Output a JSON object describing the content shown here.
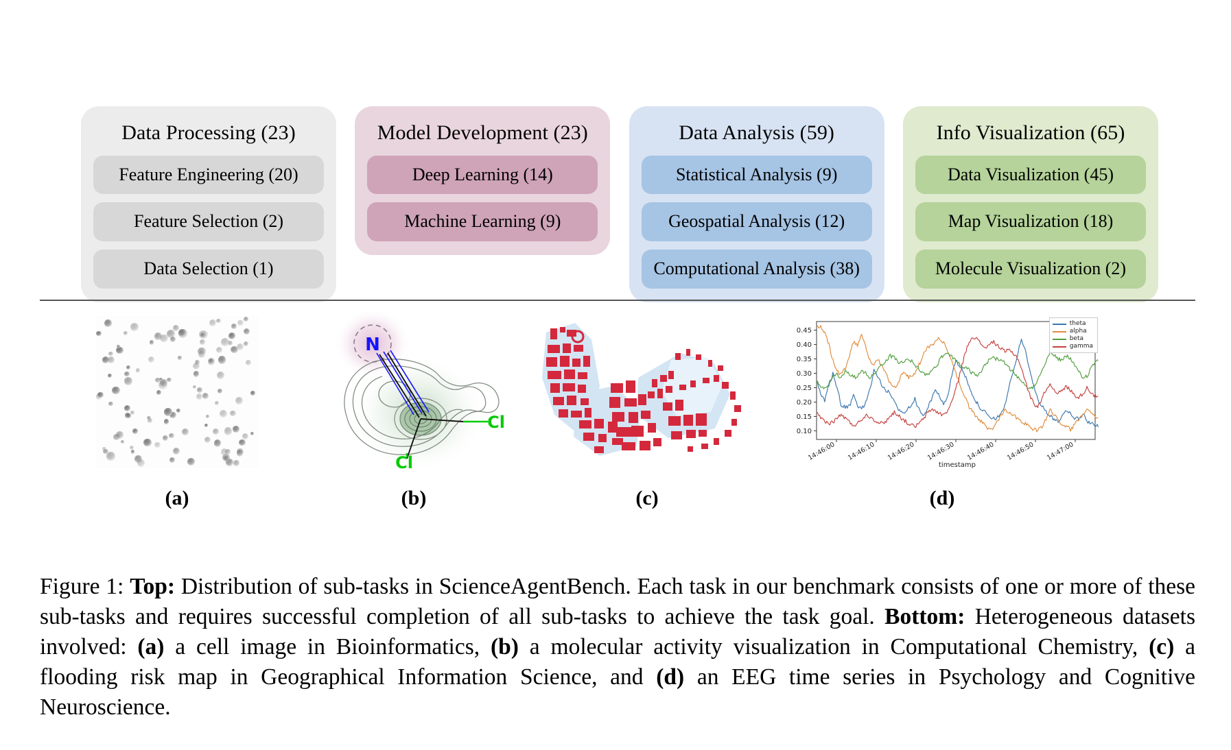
{
  "taxonomy": {
    "columns": [
      {
        "title": "Data Processing (23)",
        "panel_color": "#edecec",
        "chip_color": "#d7d7d7",
        "chips": [
          {
            "label": "Feature Engineering (20)"
          },
          {
            "label": "Feature Selection (2)"
          },
          {
            "label": "Data Selection (1)"
          }
        ]
      },
      {
        "title": "Model Development (23)",
        "panel_color": "#e9d5dd",
        "chip_color": "#cfa3b8",
        "chips": [
          {
            "label": "Deep Learning (14)"
          },
          {
            "label": "Machine Learning (9)"
          }
        ]
      },
      {
        "title": "Data Analysis (59)",
        "panel_color": "#d7e3f3",
        "chip_color": "#a6c4e4",
        "chips": [
          {
            "label": "Statistical Analysis (9)"
          },
          {
            "label": "Geospatial Analysis (12)"
          },
          {
            "label": "Computational Analysis (38)"
          }
        ]
      },
      {
        "title": "Info Visualization (65)",
        "panel_color": "#dfeacf",
        "chip_color": "#b5d39a",
        "chips": [
          {
            "label": "Data Visualization (45)"
          },
          {
            "label": "Map Visualization (18)"
          },
          {
            "label": "Molecule Visualization (2)"
          }
        ]
      }
    ]
  },
  "examples": [
    {
      "label": "(a)",
      "kind": "cell-image"
    },
    {
      "label": "(b)",
      "kind": "molecule-plot"
    },
    {
      "label": "(c)",
      "kind": "flood-risk-map"
    },
    {
      "label": "(d)",
      "kind": "eeg-time-series"
    }
  ],
  "molecule": {
    "atoms": [
      {
        "symbol": "N",
        "color": "#1414ff"
      },
      {
        "symbol": "Cl",
        "color": "#00cc00"
      }
    ]
  },
  "chart_data": {
    "type": "line",
    "title": "",
    "xlabel": "timestamp",
    "ylabel": "",
    "grid": false,
    "legend_position": "upper right",
    "ylim": [
      0.07,
      0.48
    ],
    "yticks": [
      "0.10",
      "0.15",
      "0.20",
      "0.25",
      "0.30",
      "0.35",
      "0.40",
      "0.45"
    ],
    "ytick_values": [
      0.1,
      0.15,
      0.2,
      0.25,
      0.3,
      0.35,
      0.4,
      0.45
    ],
    "xticks": [
      "14:46:00",
      "14:46:10",
      "14:46:20",
      "14:46:30",
      "14:46:40",
      "14:46:50",
      "14:47:00"
    ],
    "series": [
      {
        "name": "theta",
        "color": "#3a76af",
        "values": [
          0.27,
          0.23,
          0.2,
          0.26,
          0.3,
          0.25,
          0.19,
          0.18,
          0.185,
          0.22,
          0.19,
          0.175,
          0.2,
          0.24,
          0.31,
          0.29,
          0.255,
          0.24,
          0.23,
          0.2,
          0.175,
          0.16,
          0.175,
          0.19,
          0.21,
          0.175,
          0.155,
          0.17,
          0.21,
          0.24,
          0.22,
          0.195,
          0.22,
          0.29,
          0.35,
          0.32,
          0.3,
          0.265,
          0.23,
          0.2,
          0.18,
          0.165,
          0.15,
          0.14,
          0.145,
          0.16,
          0.19,
          0.25,
          0.31,
          0.36,
          0.42,
          0.38,
          0.31,
          0.255,
          0.21,
          0.19,
          0.165,
          0.15,
          0.14,
          0.135,
          0.15,
          0.175,
          0.16,
          0.145,
          0.14,
          0.16,
          0.135,
          0.125,
          0.12
        ]
      },
      {
        "name": "alpha",
        "color": "#e08b3c",
        "values": [
          0.465,
          0.46,
          0.44,
          0.4,
          0.345,
          0.305,
          0.295,
          0.32,
          0.36,
          0.41,
          0.4,
          0.435,
          0.39,
          0.345,
          0.33,
          0.345,
          0.33,
          0.3,
          0.265,
          0.25,
          0.27,
          0.3,
          0.29,
          0.285,
          0.3,
          0.33,
          0.36,
          0.39,
          0.395,
          0.41,
          0.425,
          0.405,
          0.38,
          0.345,
          0.3,
          0.26,
          0.225,
          0.19,
          0.165,
          0.15,
          0.135,
          0.12,
          0.105,
          0.11,
          0.13,
          0.155,
          0.175,
          0.165,
          0.155,
          0.145,
          0.135,
          0.125,
          0.115,
          0.105,
          0.1,
          0.115,
          0.14,
          0.175,
          0.155,
          0.135,
          0.125,
          0.115,
          0.105,
          0.12,
          0.14,
          0.16,
          0.18,
          0.165,
          0.15
        ]
      },
      {
        "name": "beta",
        "color": "#519e3e",
        "values": [
          0.275,
          0.255,
          0.245,
          0.26,
          0.285,
          0.295,
          0.285,
          0.31,
          0.3,
          0.285,
          0.29,
          0.305,
          0.3,
          0.285,
          0.3,
          0.315,
          0.33,
          0.345,
          0.36,
          0.355,
          0.34,
          0.335,
          0.35,
          0.345,
          0.33,
          0.315,
          0.3,
          0.295,
          0.305,
          0.32,
          0.345,
          0.365,
          0.37,
          0.36,
          0.345,
          0.33,
          0.32,
          0.315,
          0.3,
          0.29,
          0.3,
          0.325,
          0.345,
          0.355,
          0.35,
          0.345,
          0.335,
          0.32,
          0.3,
          0.285,
          0.27,
          0.255,
          0.245,
          0.255,
          0.28,
          0.31,
          0.345,
          0.37,
          0.365,
          0.35,
          0.345,
          0.36,
          0.35,
          0.33,
          0.305,
          0.285,
          0.29,
          0.315,
          0.34
        ]
      },
      {
        "name": "gamma",
        "color": "#c3423f",
        "values": [
          0.16,
          0.145,
          0.135,
          0.125,
          0.13,
          0.145,
          0.155,
          0.145,
          0.13,
          0.12,
          0.125,
          0.14,
          0.155,
          0.15,
          0.14,
          0.13,
          0.125,
          0.135,
          0.15,
          0.165,
          0.155,
          0.14,
          0.13,
          0.12,
          0.115,
          0.125,
          0.14,
          0.16,
          0.175,
          0.17,
          0.16,
          0.155,
          0.17,
          0.2,
          0.245,
          0.3,
          0.355,
          0.4,
          0.43,
          0.42,
          0.405,
          0.39,
          0.395,
          0.41,
          0.4,
          0.385,
          0.375,
          0.38,
          0.37,
          0.355,
          0.32,
          0.27,
          0.225,
          0.195,
          0.185,
          0.21,
          0.245,
          0.26,
          0.245,
          0.23,
          0.24,
          0.255,
          0.24,
          0.225,
          0.215,
          0.23,
          0.25,
          0.235,
          0.22
        ]
      }
    ]
  },
  "caption": {
    "prefix": "Figure 1:",
    "top_label": "Top:",
    "top_text": "Distribution of sub-tasks in ScienceAgentBench. Each task in our benchmark consists of one or more of these sub-tasks and requires successful completion of all sub-tasks to achieve the task goal.",
    "bottom_label": "Bottom:",
    "bottom_text_1": "Heterogeneous datasets involved:",
    "item_a_label": "(a)",
    "item_a_text": "a cell image in Bioinformatics,",
    "item_b_label": "(b)",
    "item_b_text": "a molecular activity visualization in Computational Chemistry,",
    "item_c_label": "(c)",
    "item_c_text": "a flooding risk map in Geographical Information Science, and",
    "item_d_label": "(d)",
    "item_d_text": "an EEG time series in Psychology and Cognitive Neuroscience."
  }
}
